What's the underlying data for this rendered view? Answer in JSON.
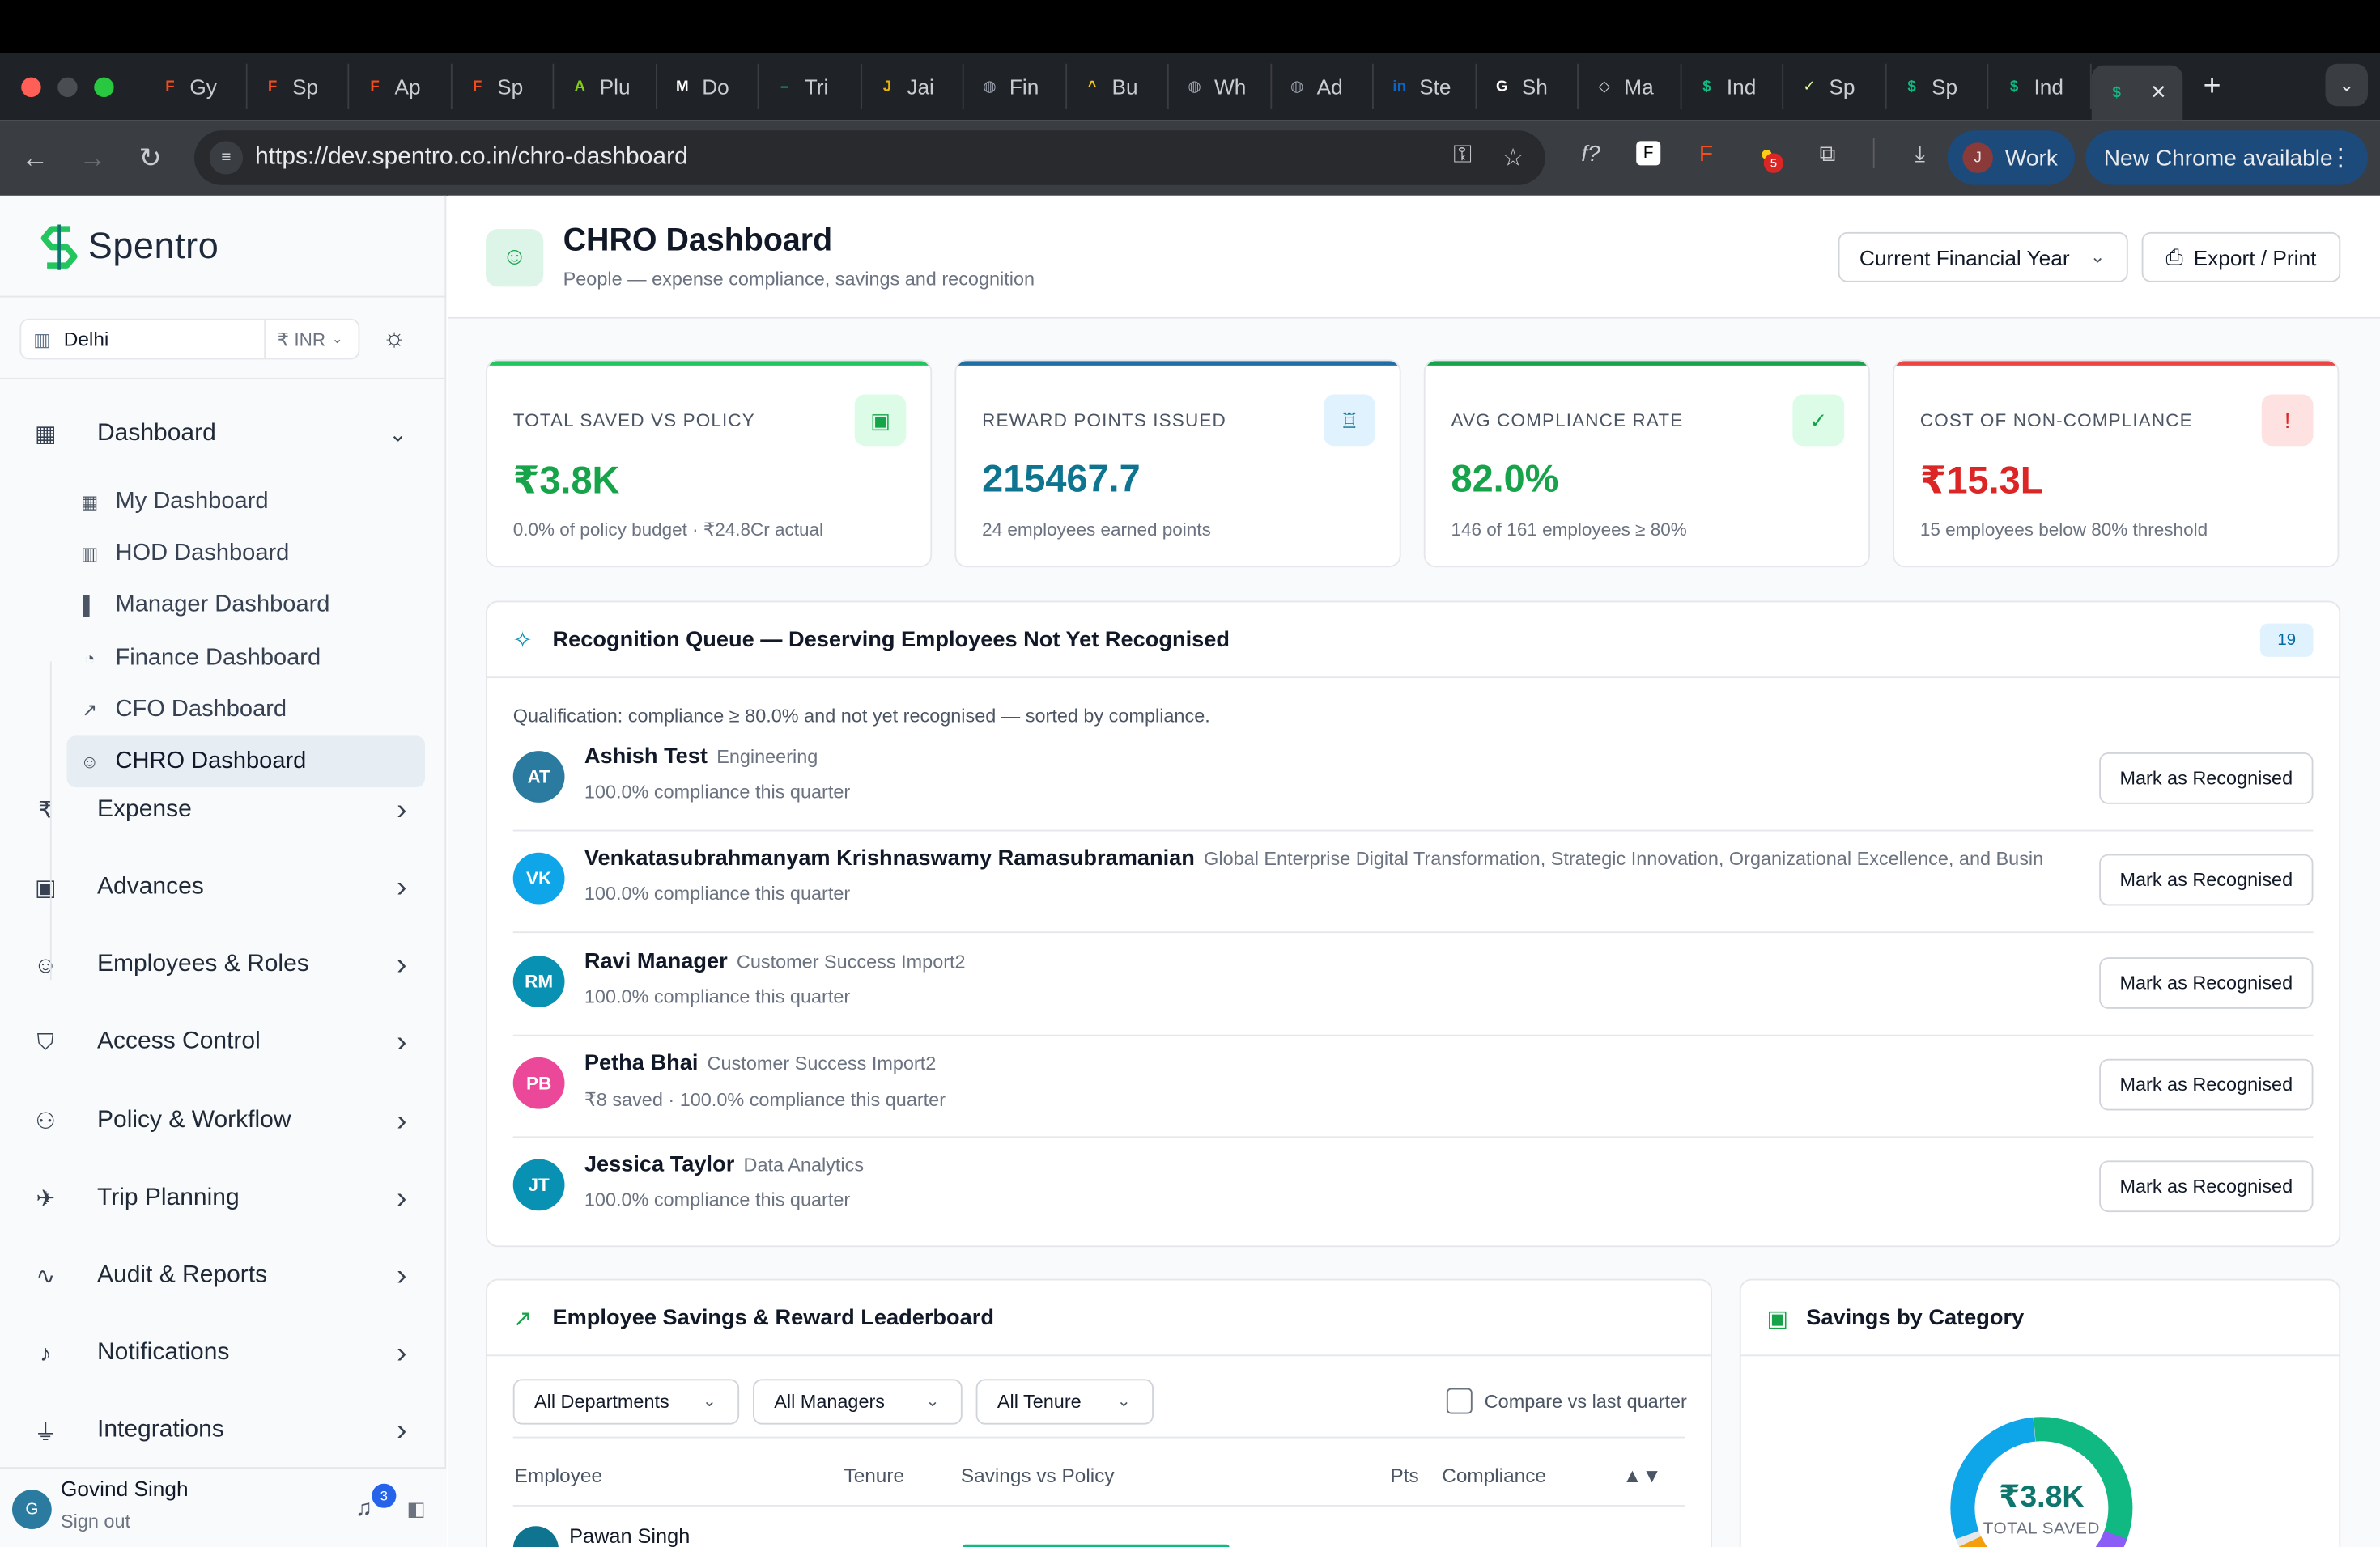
{
  "browser": {
    "tabs": [
      {
        "label": "Gy",
        "fav_color": "#f24e1e",
        "fav_glyph": "F"
      },
      {
        "label": "Sp",
        "fav_color": "#f24e1e",
        "fav_glyph": "F"
      },
      {
        "label": "Ap",
        "fav_color": "#f24e1e",
        "fav_glyph": "F"
      },
      {
        "label": "Sp",
        "fav_color": "#f24e1e",
        "fav_glyph": "F"
      },
      {
        "label": "Plu",
        "fav_color": "#84cc16",
        "fav_glyph": "A"
      },
      {
        "label": "Do",
        "fav_color": "#ffffff",
        "fav_glyph": "M"
      },
      {
        "label": "Tri",
        "fav_color": "#14b8a6",
        "fav_glyph": "–"
      },
      {
        "label": "Jai",
        "fav_color": "#eab308",
        "fav_glyph": "J"
      },
      {
        "label": "Fin",
        "fav_color": "#9ca3af",
        "fav_glyph": "◍"
      },
      {
        "label": "Bu",
        "fav_color": "#facc15",
        "fav_glyph": "^"
      },
      {
        "label": "Wh",
        "fav_color": "#9ca3af",
        "fav_glyph": "◍"
      },
      {
        "label": "Ad",
        "fav_color": "#9ca3af",
        "fav_glyph": "◍"
      },
      {
        "label": "Ste",
        "fav_color": "#0a66c2",
        "fav_glyph": "in"
      },
      {
        "label": "Sh",
        "fav_color": "#ffffff",
        "fav_glyph": "G"
      },
      {
        "label": "Ma",
        "fav_color": "#d1d5db",
        "fav_glyph": "◇"
      },
      {
        "label": "Ind",
        "fav_color": "#10b981",
        "fav_glyph": "$"
      },
      {
        "label": "Sp",
        "fav_color": "#d9f99d",
        "fav_glyph": "✓"
      },
      {
        "label": "Sp",
        "fav_color": "#10b981",
        "fav_glyph": "$"
      },
      {
        "label": "Ind",
        "fav_color": "#10b981",
        "fav_glyph": "$"
      }
    ],
    "active_tab": {
      "fav_glyph": "$",
      "close": "✕"
    },
    "new_tab": "+",
    "tab_menu": "⌄",
    "url": "https://dev.spentro.co.in/chro-dashboard",
    "profile_initial": "J",
    "profile_label": "Work",
    "update_label": "New Chrome available",
    "ext_badge": "5"
  },
  "sidebar": {
    "brand": "Spentro",
    "location": "Delhi",
    "currency": "₹ INR",
    "nav": [
      {
        "label": "Dashboard",
        "icon": "grid-icon",
        "glyph": "▦",
        "expanded": true
      },
      {
        "label": "Expense",
        "icon": "receipt-icon",
        "glyph": "₹"
      },
      {
        "label": "Advances",
        "icon": "wallet-icon",
        "glyph": "▣"
      },
      {
        "label": "Employees & Roles",
        "icon": "users-icon",
        "glyph": "☺"
      },
      {
        "label": "Access Control",
        "icon": "shield-icon",
        "glyph": "⛉"
      },
      {
        "label": "Policy & Workflow",
        "icon": "workflow-icon",
        "glyph": "⚇"
      },
      {
        "label": "Trip Planning",
        "icon": "plane-icon",
        "glyph": "✈"
      },
      {
        "label": "Audit & Reports",
        "icon": "activity-icon",
        "glyph": "∿"
      },
      {
        "label": "Notifications",
        "icon": "bell-icon",
        "glyph": "♪"
      },
      {
        "label": "Integrations",
        "icon": "plug-icon",
        "glyph": "⏚"
      }
    ],
    "subnav": [
      {
        "label": "My Dashboard",
        "glyph": "▦"
      },
      {
        "label": "HOD Dashboard",
        "glyph": "▥"
      },
      {
        "label": "Manager Dashboard",
        "glyph": "▌"
      },
      {
        "label": "Finance Dashboard",
        "glyph": "◔"
      },
      {
        "label": "CFO Dashboard",
        "glyph": "↗"
      },
      {
        "label": "CHRO Dashboard",
        "glyph": "☺",
        "active": true
      }
    ],
    "user": {
      "initial": "G",
      "name": "Govind Singh",
      "signout": "Sign out",
      "notifications": "3"
    }
  },
  "header": {
    "title": "CHRO Dashboard",
    "subtitle": "People — expense compliance, savings and recognition",
    "period": "Current Financial Year",
    "export": "Export / Print"
  },
  "kpis": [
    {
      "label": "TOTAL SAVED VS POLICY",
      "value": "₹3.8K",
      "sub": "0.0% of policy budget · ₹24.8Cr actual",
      "color": "#16a34a",
      "bar": "#22c55e",
      "icon_bg": "#dcfce7",
      "icon": "wallet-icon",
      "glyph": "▣"
    },
    {
      "label": "REWARD POINTS ISSUED",
      "value": "215467.7",
      "sub": "24 employees earned points",
      "color": "#0e7490",
      "bar": "#1d6fa5",
      "icon_bg": "#e0f2fe",
      "icon": "award-icon",
      "glyph": "♖"
    },
    {
      "label": "AVG COMPLIANCE RATE",
      "value": "82.0%",
      "sub": "146 of 161 employees ≥ 80%",
      "color": "#16a34a",
      "bar": "#16a34a",
      "icon_bg": "#dcfce7",
      "icon": "shield-check-icon",
      "glyph": "✓"
    },
    {
      "label": "COST OF NON-COMPLIANCE",
      "value": "₹15.3L",
      "sub": "15 employees below 80% threshold",
      "color": "#dc2626",
      "bar": "#ef4444",
      "icon_bg": "#fee2e2",
      "icon": "shield-alert-icon",
      "glyph": "!"
    }
  ],
  "queue": {
    "title": "Recognition Queue — Deserving Employees Not Yet Recognised",
    "count": "19",
    "qualification": "Qualification: compliance ≥ 80.0% and not yet recognised — sorted by compliance.",
    "button_label": "Mark as Recognised",
    "rows": [
      {
        "initials": "AT",
        "name": "Ashish Test",
        "dept": "Engineering",
        "sub": "100.0% compliance this quarter",
        "color": "#2b7a9f"
      },
      {
        "initials": "VK",
        "name": "Venkatasubrahmanyam Krishnaswamy Ramasubramanian",
        "dept": "Global Enterprise Digital Transformation, Strategic Innovation, Organizational Excellence, and Busin",
        "sub": "100.0% compliance this quarter",
        "color": "#0ea5e9"
      },
      {
        "initials": "RM",
        "name": "Ravi Manager",
        "dept": "Customer Success Import2",
        "sub": "100.0% compliance this quarter",
        "color": "#0891b2"
      },
      {
        "initials": "PB",
        "name": "Petha Bhai",
        "dept": "Customer Success Import2",
        "sub": "₹8 saved · 100.0% compliance this quarter",
        "color": "#ec4899"
      },
      {
        "initials": "JT",
        "name": "Jessica Taylor",
        "dept": "Data Analytics",
        "sub": "100.0% compliance this quarter",
        "color": "#0891b2"
      }
    ]
  },
  "leaderboard": {
    "title": "Employee Savings & Reward Leaderboard",
    "filters": [
      "All Departments",
      "All Managers",
      "All Tenure"
    ],
    "compare": "Compare vs last quarter",
    "columns": [
      "Employee",
      "Tenure",
      "Savings vs Policy",
      "Pts",
      "Compliance",
      "▲▼"
    ],
    "first_row": {
      "name": "Pawan Singh"
    }
  },
  "savings": {
    "title": "Savings by Category",
    "total": "₹3.8K",
    "total_label": "TOTAL SAVED"
  }
}
